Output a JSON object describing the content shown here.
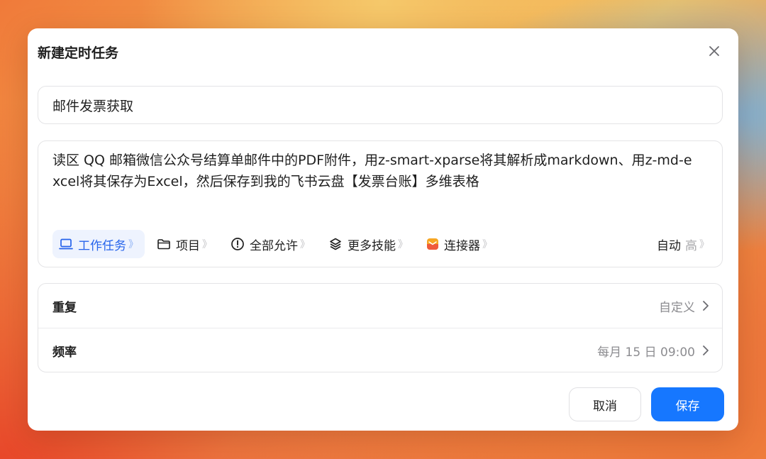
{
  "dialog": {
    "title": "新建定时任务",
    "close_icon": "close-icon"
  },
  "task_name": {
    "value": "邮件发票获取"
  },
  "prompt": {
    "text": "读区 QQ 邮箱微信公众号结算单邮件中的PDF附件，用z-smart-xparse将其解析成markdown、用z-md-excel将其保存为Excel，然后保存到我的飞书云盘【发票台账】多维表格"
  },
  "toolbar": {
    "work_task": {
      "label": "工作任务",
      "icon": "laptop-icon",
      "active": true
    },
    "project": {
      "label": "项目",
      "icon": "folder-icon"
    },
    "permission": {
      "label": "全部允许",
      "icon": "alert-circle-icon"
    },
    "skills": {
      "label": "更多技能",
      "icon": "layers-icon"
    },
    "connector": {
      "label": "连接器",
      "icon": "mail-app-icon"
    },
    "chevron": "》",
    "mode": {
      "label": "自动",
      "level": "高"
    }
  },
  "settings": {
    "repeat": {
      "label": "重复",
      "value": "自定义"
    },
    "frequency": {
      "label": "频率",
      "value": "每月 15 日 09:00"
    }
  },
  "footer": {
    "cancel_label": "取消",
    "save_label": "保存"
  },
  "colors": {
    "primary": "#1677ff",
    "active_bg": "#eef3fe",
    "active_text": "#2563eb"
  }
}
